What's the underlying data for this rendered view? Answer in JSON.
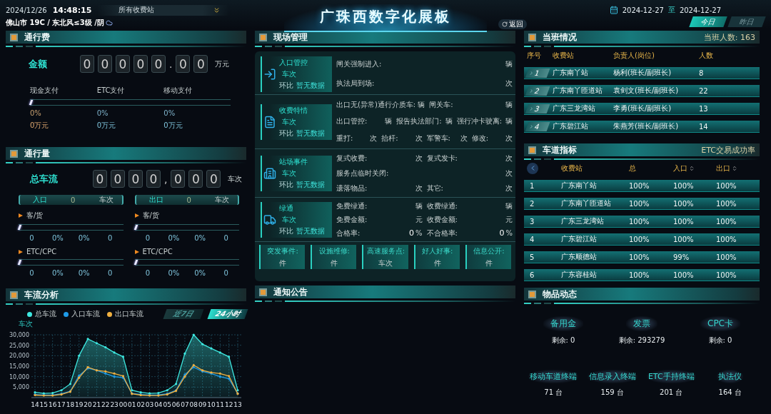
{
  "header": {
    "date": "2024/12/26",
    "time": "14:48:15",
    "station_select": "所有收费站",
    "weather": "佛山市 19C / 东北风≤3级 /阴",
    "title": "广珠西数字化展板",
    "reset_button": "返回",
    "date_from": "2024-12-27",
    "date_sep": "至",
    "date_to": "2024-12-27",
    "tabs": [
      {
        "label": "今日",
        "selected": true
      },
      {
        "label": "昨日",
        "selected": false
      }
    ]
  },
  "toll": {
    "title": "通行费",
    "amount_label": "金额",
    "digits": [
      {
        "kind": "digit",
        "text": "0"
      },
      {
        "kind": "digit",
        "text": "0"
      },
      {
        "kind": "digit",
        "text": "0"
      },
      {
        "kind": "digit",
        "text": "0"
      },
      {
        "kind": "digit",
        "text": "0"
      },
      {
        "kind": "sep",
        "text": "."
      },
      {
        "kind": "digit",
        "text": "0"
      },
      {
        "kind": "digit",
        "text": "0"
      }
    ],
    "unit": "万元",
    "payments": [
      {
        "label": "现金支付",
        "percent": "0%",
        "amount": "0万元"
      },
      {
        "label": "ETC支付",
        "percent": "0%",
        "amount": "0万元"
      },
      {
        "label": "移动支付",
        "percent": "0%",
        "amount": "0万元"
      }
    ],
    "level": 0
  },
  "traffic": {
    "title": "通行量",
    "total_label": "总车流",
    "digits": [
      {
        "kind": "digit",
        "text": "0"
      },
      {
        "kind": "digit",
        "text": "0"
      },
      {
        "kind": "digit",
        "text": "0"
      },
      {
        "kind": "digit",
        "text": "0"
      },
      {
        "kind": "sep",
        "text": ","
      },
      {
        "kind": "digit",
        "text": "0"
      },
      {
        "kind": "digit",
        "text": "0"
      },
      {
        "kind": "digit",
        "text": "0"
      }
    ],
    "unit": "车次",
    "sides": [
      {
        "label": "入口",
        "count": "0",
        "unit": "车次",
        "groups": [
          {
            "label": "客/货",
            "level": 0,
            "values": [
              "0",
              "0%",
              "0%",
              "0"
            ]
          },
          {
            "label": "ETC/CPC",
            "level": 0,
            "values": [
              "0",
              "0%",
              "0%",
              "0"
            ]
          }
        ]
      },
      {
        "label": "出口",
        "count": "0",
        "unit": "车次",
        "groups": [
          {
            "label": "客/货",
            "level": 0,
            "values": [
              "0",
              "0%",
              "0%",
              "0"
            ]
          },
          {
            "label": "ETC/CPC",
            "level": 0,
            "values": [
              "0",
              "0%",
              "0%",
              "0"
            ]
          }
        ]
      }
    ]
  },
  "flow_analysis": {
    "title": "车流分析",
    "tabs": [
      {
        "label": "近7日",
        "selected": false
      },
      {
        "label": "24小时",
        "selected": true
      }
    ],
    "chart_data": {
      "type": "area",
      "grid": true,
      "ylabel": "车次",
      "categories": [
        "14",
        "15",
        "16",
        "17",
        "18",
        "19",
        "20",
        "21",
        "22",
        "23",
        "00",
        "01",
        "02",
        "03",
        "04",
        "05",
        "06",
        "07",
        "08",
        "09",
        "10",
        "11",
        "12",
        "13"
      ],
      "ylim": [
        0,
        30000
      ],
      "yticks": [
        {
          "value": 5000,
          "label": "5,000"
        },
        {
          "value": 10000,
          "label": "10,000"
        },
        {
          "value": 15000,
          "label": "15,000"
        },
        {
          "value": 20000,
          "label": "20,000"
        },
        {
          "value": 25000,
          "label": "25,000"
        },
        {
          "value": 30000,
          "label": "30,000"
        }
      ],
      "series": [
        {
          "name": "总车流",
          "color": "#3ee8e0",
          "values": [
            2500,
            2000,
            2200,
            3500,
            6500,
            20000,
            28000,
            26000,
            24000,
            21500,
            19500,
            3500,
            2500,
            2000,
            2200,
            3500,
            6500,
            21000,
            30000,
            25500,
            23500,
            21500,
            19500,
            3500
          ]
        },
        {
          "name": "入口车流",
          "type": "line",
          "color": "#1e9be8",
          "values": [
            1500,
            1200,
            1200,
            1800,
            3000,
            10500,
            14000,
            13000,
            11500,
            10000,
            9500,
            2000,
            1500,
            1200,
            1300,
            1800,
            3500,
            11000,
            14500,
            12500,
            11500,
            10000,
            9000,
            2000
          ]
        },
        {
          "name": "出口车流",
          "type": "line",
          "color": "#f0b040",
          "values": [
            1200,
            1000,
            1000,
            1500,
            2800,
            9500,
            14500,
            13000,
            12500,
            11500,
            10300,
            1800,
            1200,
            1000,
            1000,
            1500,
            3200,
            10000,
            15500,
            13000,
            12000,
            11500,
            10300,
            1800
          ]
        }
      ]
    }
  },
  "site": {
    "title": "现场管理",
    "rows": [
      {
        "kind": "entry",
        "title": "入口管控",
        "unit": "车次",
        "compare_label": "环比",
        "compare_value": "暂无数据",
        "lines": [
          [
            {
              "label": "闸关强制进入:",
              "unit": "辆"
            }
          ],
          [
            {
              "label": "执法局到场:",
              "unit": "次"
            }
          ]
        ]
      },
      {
        "kind": "toll",
        "title": "收费特情",
        "unit": "车次",
        "compare_label": "环比",
        "compare_value": "暂无数据",
        "lines": [
          [
            {
              "label": "出口无(异常)通行介质车:",
              "unit": "辆"
            },
            {
              "label": "闸关车:",
              "unit": "辆"
            }
          ],
          [
            {
              "label": "出口管控:",
              "unit": "辆"
            },
            {
              "label": "报告执法部门:",
              "unit": "辆"
            },
            {
              "label": "强行冲卡驶离:",
              "unit": "辆"
            }
          ],
          [
            {
              "label": "重打:",
              "unit": "次"
            },
            {
              "label": "抬杆:",
              "unit": "次"
            },
            {
              "label": "军警车:",
              "unit": "次"
            },
            {
              "label": "修改:",
              "unit": "次"
            }
          ]
        ]
      },
      {
        "kind": "station",
        "title": "站场事件",
        "unit": "车次",
        "compare_label": "环比",
        "compare_value": "暂无数据",
        "lines": [
          [
            {
              "label": "复式收费:",
              "unit": "次"
            },
            {
              "label": "复式发卡:",
              "unit": "次"
            }
          ],
          [
            {
              "label": "服务点临时关闭:",
              "unit": "次"
            }
          ],
          [
            {
              "label": "遗落物品:",
              "unit": "次"
            },
            {
              "label": "其它:",
              "unit": "次"
            }
          ]
        ]
      },
      {
        "kind": "truck",
        "title": "绿通",
        "unit": "车次",
        "compare_label": "环比",
        "compare_value": "暂无数据",
        "lines": [
          [
            {
              "label": "免费绿通:",
              "unit": "辆"
            },
            {
              "label": "收费绿通:",
              "unit": "辆"
            }
          ],
          [
            {
              "label": "免费金额:",
              "unit": "元"
            },
            {
              "label": "收费金额:",
              "unit": "元"
            }
          ],
          [
            {
              "label": "合格率:",
              "value": "0",
              "unit": "%"
            },
            {
              "label": "不合格率:",
              "value": "0",
              "unit": "%"
            }
          ]
        ]
      }
    ],
    "cards": [
      {
        "label": "突发事件:",
        "unit": "件"
      },
      {
        "label": "设施维修:",
        "unit": "件"
      },
      {
        "label": "高速服务点:",
        "unit": "车次"
      },
      {
        "label": "好人好事:",
        "unit": "件"
      },
      {
        "label": "信息公开:",
        "unit": "件"
      }
    ]
  },
  "notice": {
    "title": "通知公告"
  },
  "duty": {
    "title": "当班情况",
    "extra": "当班人数: 163",
    "columns": [
      "序号",
      "收费站",
      "负责人(岗位)",
      "人数"
    ],
    "rows": [
      [
        "1",
        "广东南丫站",
        "杨利(班长/副班长)",
        "8"
      ],
      [
        "2",
        "广东南丫匝道站",
        "袁剑文(班长/副班长)",
        "22"
      ],
      [
        "3",
        "广东三龙湾站",
        "李勇(班长/副班长)",
        "13"
      ],
      [
        "4",
        "广东碧江站",
        "朱燕芳(班长/副班长)",
        "14"
      ]
    ]
  },
  "lanes": {
    "title": "车道指标",
    "extra": "ETC交易成功率",
    "columns": [
      {
        "kind": "back"
      },
      {
        "label": "收费站",
        "sortable": false
      },
      {
        "label": "总",
        "sortable": false
      },
      {
        "label": "入口",
        "sortable": true
      },
      {
        "label": "出口",
        "sortable": true
      }
    ],
    "rows": [
      [
        "1",
        "广东南丫站",
        "100%",
        "100%",
        "100%"
      ],
      [
        "2",
        "广东南丫匝道站",
        "100%",
        "100%",
        "100%"
      ],
      [
        "3",
        "广东三龙湾站",
        "100%",
        "100%",
        "100%"
      ],
      [
        "4",
        "广东碧江站",
        "100%",
        "100%",
        "100%"
      ],
      [
        "5",
        "广东顺德站",
        "100%",
        "99%",
        "100%"
      ],
      [
        "6",
        "广东容桂站",
        "100%",
        "100%",
        "100%"
      ]
    ]
  },
  "goods": {
    "title": "物品动态",
    "stock": [
      {
        "label": "备用金",
        "remain": "剩余: 0"
      },
      {
        "label": "发票",
        "remain": "剩余: 293279"
      },
      {
        "label": "CPC卡",
        "remain": "剩余: 0"
      }
    ],
    "devices": [
      {
        "label": "移动车道终端",
        "count": "71 台"
      },
      {
        "label": "信息录入终端",
        "count": "159 台"
      },
      {
        "label": "ETC手持终端",
        "count": "201 台"
      },
      {
        "label": "执法仪",
        "count": "164 台"
      }
    ]
  }
}
